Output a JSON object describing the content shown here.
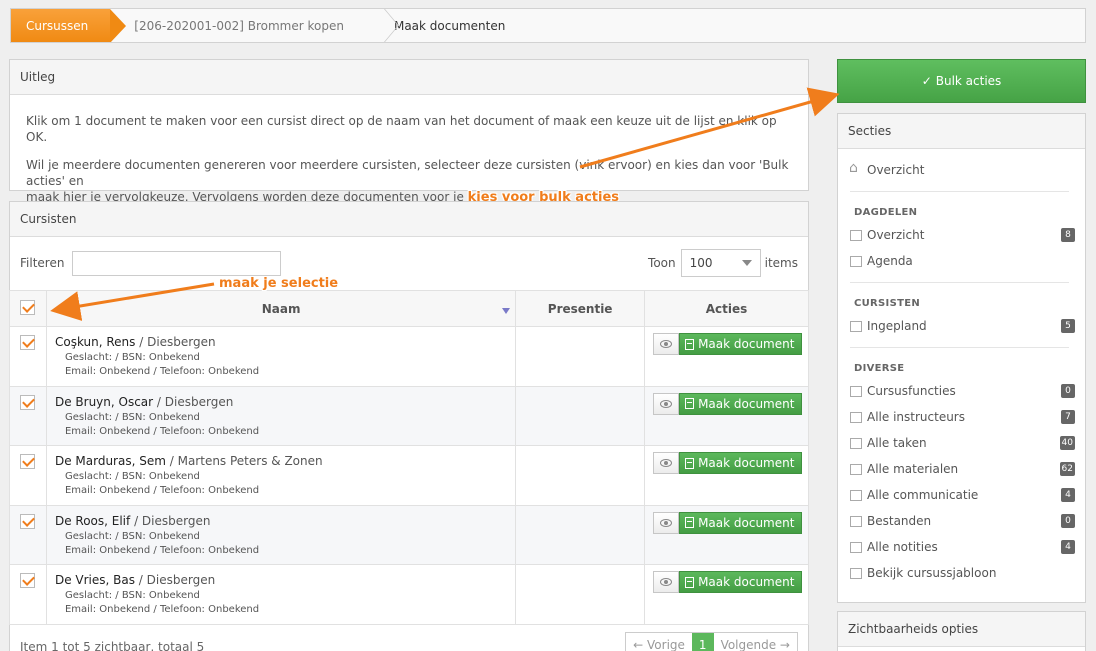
{
  "breadcrumb": {
    "home": "Cursussen",
    "course": "[206-202001-002] Brommer kopen",
    "current": "Maak documenten"
  },
  "uitleg": {
    "title": "Uitleg",
    "p1": "Klik om 1 document te maken voor een cursist direct op de naam van het document of maak een keuze uit de lijst en klik op OK.",
    "p2a": "Wil je meerdere documenten genereren voor meerdere cursisten, selecteer deze cursisten (vink ervoor) en kies dan voor 'Bulk acties' en",
    "p2b": "maak hier je vervolgkeuze. Vervolgens worden deze documenten voor je ",
    "annotation_bulk": "kies voor bulk acties"
  },
  "cursisten": {
    "title": "Cursisten",
    "filter_label": "Filteren",
    "filter_value": "",
    "toon_label": "Toon",
    "toon_value": "100",
    "items_label": "items",
    "annotation_select": "maak je selectie",
    "columns": {
      "naam": "Naam",
      "presentie": "Presentie",
      "acties": "Acties"
    },
    "view_icon": "eye-icon",
    "doc_icon": "pdf-file-icon",
    "make_doc_label": "Maak document",
    "rows": [
      {
        "name": "Coşkun, Rens",
        "org": " / Diesbergen",
        "l1": "Geslacht:  / BSN: Onbekend",
        "l2": "Email: Onbekend / Telefoon: Onbekend"
      },
      {
        "name": "De Bruyn, Oscar",
        "org": " / Diesbergen",
        "l1": "Geslacht:  / BSN: Onbekend",
        "l2": "Email: Onbekend / Telefoon: Onbekend"
      },
      {
        "name": "De Marduras, Sem",
        "org": " / Martens Peters & Zonen",
        "l1": "Geslacht:  / BSN: Onbekend",
        "l2": "Email: Onbekend / Telefoon: Onbekend"
      },
      {
        "name": "De Roos, Elif",
        "org": " / Diesbergen",
        "l1": "Geslacht:  / BSN: Onbekend",
        "l2": "Email: Onbekend / Telefoon: Onbekend"
      },
      {
        "name": "De Vries, Bas",
        "org": " / Diesbergen",
        "l1": "Geslacht:  / BSN: Onbekend",
        "l2": "Email: Onbekend / Telefoon: Onbekend"
      }
    ],
    "footer": "Item 1 tot 5 zichtbaar, totaal 5",
    "pager": {
      "prev": "← Vorige",
      "page": "1",
      "next": "Volgende →"
    }
  },
  "bulk_button": {
    "check": "✓",
    "label": "Bulk acties"
  },
  "secties": {
    "title": "Secties",
    "top": {
      "label": "Overzicht",
      "icon": "home-icon"
    },
    "groups": [
      {
        "title": "DAGDELEN",
        "items": [
          {
            "label": "Overzicht",
            "badge": "8",
            "icon": "list-icon"
          },
          {
            "label": "Agenda",
            "badge": "",
            "icon": "calendar-icon"
          }
        ]
      },
      {
        "title": "CURSISTEN",
        "items": [
          {
            "label": "Ingepland",
            "badge": "5",
            "icon": "document-icon"
          }
        ]
      },
      {
        "title": "DIVERSE",
        "items": [
          {
            "label": "Cursusfuncties",
            "badge": "0",
            "icon": "user-icon"
          },
          {
            "label": "Alle instructeurs",
            "badge": "7",
            "icon": "users-icon"
          },
          {
            "label": "Alle taken",
            "badge": "40",
            "icon": "tasks-icon"
          },
          {
            "label": "Alle materialen",
            "badge": "62",
            "icon": "truck-icon"
          },
          {
            "label": "Alle communicatie",
            "badge": "4",
            "icon": "chat-icon"
          },
          {
            "label": "Bestanden",
            "badge": "0",
            "icon": "files-icon"
          },
          {
            "label": "Alle notities",
            "badge": "4",
            "icon": "note-icon"
          },
          {
            "label": "Bekijk cursussjabloon",
            "badge": "",
            "icon": "template-icon"
          }
        ]
      }
    ]
  },
  "zichtbaarheid": {
    "title": "Zichtbaarheids opties"
  },
  "colors": {
    "accent_orange": "#f08a13",
    "button_green": "#4cae4c",
    "annotation": "#f07d1c"
  }
}
